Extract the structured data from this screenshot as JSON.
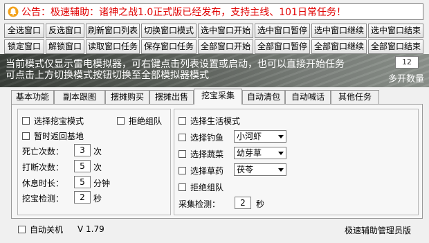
{
  "notice": {
    "text": "公告：极速辅助：诸神之战1.0正式版已经发布，支持主线、101日常任务！",
    "icon": "bell-icon",
    "color": "#e00000"
  },
  "toolbar": {
    "row1": [
      "全选窗口",
      "反选窗口",
      "刷新窗口列表",
      "切换窗口模式",
      "选中窗口开始",
      "选中窗口暂停",
      "选中窗口继续",
      "选中窗口结束"
    ],
    "row2": [
      "锁定窗口",
      "解锁窗口",
      "读取窗口任务",
      "保存窗口任务",
      "全部窗口开始",
      "全部窗口暂停",
      "全部窗口继续",
      "全部窗口结束"
    ]
  },
  "banner": {
    "line1": "当前模式仅显示雷电模拟器，可右键点击列表设置或启动，也可以直接开始任务",
    "line2": "可点击上方切换模式按钮切换至全部模拟器模式",
    "multi_count": "12",
    "multi_label": "多开数量"
  },
  "tabs": [
    "基本功能",
    "副本跟图",
    "摆摊购买",
    "摆摊出售",
    "挖宝采集",
    "自动清包",
    "自动喊话",
    "其他任务"
  ],
  "active_tab": "挖宝采集",
  "treasure": {
    "select_mode": "选择挖宝模式",
    "refuse_team": "拒绝组队",
    "return_base": "暂时返回基地",
    "deaths_label": "死亡次数：",
    "deaths_value": "3",
    "deaths_unit": "次",
    "interrupt_label": "打断次数：",
    "interrupt_value": "5",
    "interrupt_unit": "次",
    "rest_label": "休息时长：",
    "rest_value": "5",
    "rest_unit": "分钟",
    "detect_label": "挖宝检测：",
    "detect_value": "2",
    "detect_unit": "秒"
  },
  "gather": {
    "select_mode": "选择生活模式",
    "fishing": "选择钓鱼",
    "fishing_value": "小河虾",
    "vegetable": "选择蔬菜",
    "vegetable_value": "幼芽草",
    "herb": "选择草药",
    "herb_value": "茯苓",
    "refuse_team": "拒绝组队",
    "detect_label": "采集检测：",
    "detect_value": "2",
    "detect_unit": "秒"
  },
  "status": {
    "auto_shutdown": "自动关机",
    "version": "V 1.79",
    "edition": "极速辅助管理员版"
  }
}
